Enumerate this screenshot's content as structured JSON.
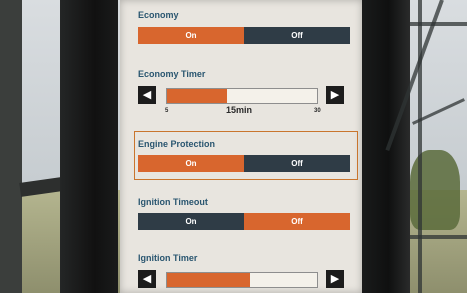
{
  "settings": {
    "economy": {
      "label": "Economy",
      "on_label": "On",
      "off_label": "Off",
      "selected": "On"
    },
    "economy_timer": {
      "label": "Economy Timer",
      "min_label": "5",
      "max_label": "30",
      "value_label": "15min",
      "fill_fraction": 0.4
    },
    "engine_protection": {
      "label": "Engine Protection",
      "on_label": "On",
      "off_label": "Off",
      "selected": "On"
    },
    "ignition_timeout": {
      "label": "Ignition Timeout",
      "on_label": "On",
      "off_label": "Off",
      "selected": "Off"
    },
    "ignition_timer": {
      "label": "Ignition Timer",
      "fill_fraction": 0.55
    }
  },
  "icons": {
    "decrease": "left-arrow-icon",
    "increase": "right-arrow-icon"
  },
  "colors": {
    "accent": "#d8662e",
    "inactive": "#2f3c46",
    "label": "#2a5670",
    "screen_bg": "#e8e5df"
  }
}
